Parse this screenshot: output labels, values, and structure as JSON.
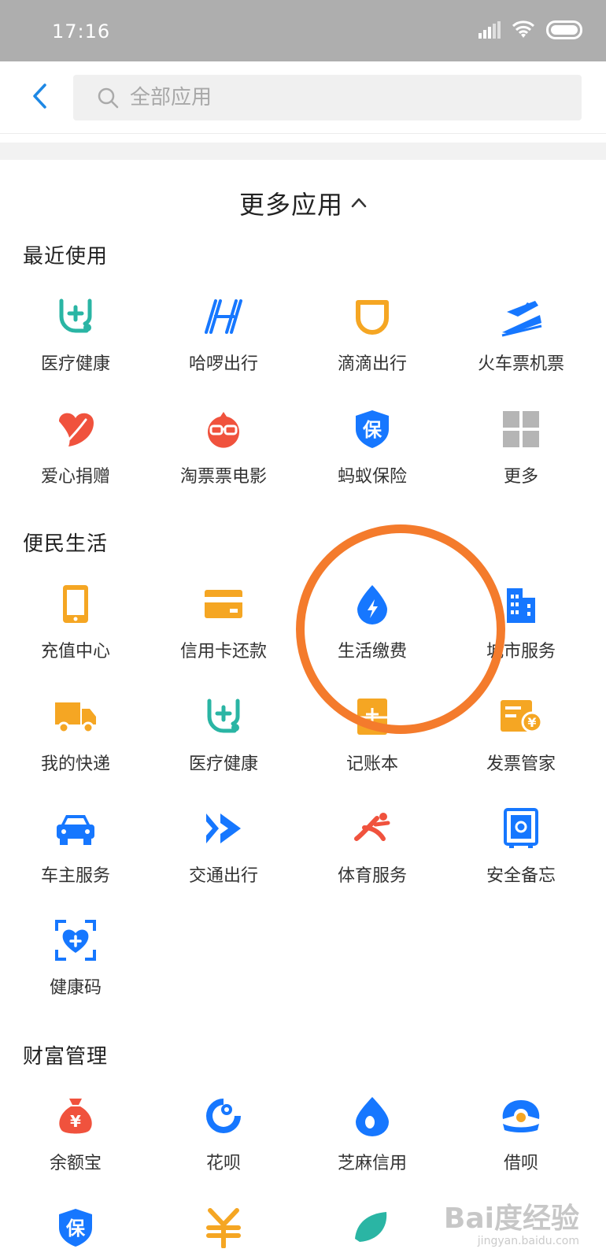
{
  "status_bar": {
    "time": "17:16"
  },
  "search": {
    "placeholder": "全部应用"
  },
  "more_apps": {
    "title": "更多应用"
  },
  "sections": {
    "recent": {
      "title": "最近使用",
      "items": [
        "医疗健康",
        "哈啰出行",
        "滴滴出行",
        "火车票机票",
        "爱心捐赠",
        "淘票票电影",
        "蚂蚁保险",
        "更多"
      ]
    },
    "life": {
      "title": "便民生活",
      "items": [
        "充值中心",
        "信用卡还款",
        "生活缴费",
        "城市服务",
        "我的快递",
        "医疗健康",
        "记账本",
        "发票管家",
        "车主服务",
        "交通出行",
        "体育服务",
        "安全备忘",
        "健康码"
      ]
    },
    "wealth": {
      "title": "财富管理",
      "items": [
        "余额宝",
        "花呗",
        "芝麻信用",
        "借呗"
      ]
    }
  },
  "watermark": {
    "main": "Bai度经验",
    "sub": "jingyan.baidu.com"
  },
  "colors": {
    "accent_blue": "#1677ff",
    "orange": "#f5a623",
    "teal": "#2ab5a4",
    "red": "#f0523d",
    "highlight": "#f47b2c"
  }
}
